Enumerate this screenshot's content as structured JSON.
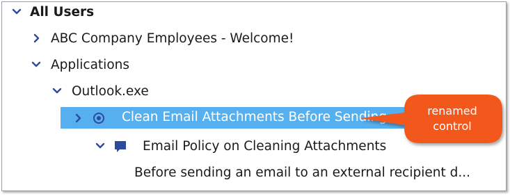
{
  "tree": {
    "root": {
      "label": "All Users"
    },
    "items": [
      {
        "label": "ABC Company Employees - Welcome!"
      },
      {
        "label": "Applications"
      },
      {
        "label": "Outlook.exe"
      },
      {
        "label": "Clean Email Attachments Before Sending"
      },
      {
        "label": "Email Policy on Cleaning Attachments"
      },
      {
        "label": "Before sending an email to an external recipient d..."
      }
    ]
  },
  "callout": {
    "line1": "renamed",
    "line2": "control"
  },
  "colors": {
    "selection": "#56b0ef",
    "chevron": "#2e4a9a",
    "callout": "#f2581e"
  },
  "icons": {
    "expand": "chevron-right-icon",
    "collapse": "chevron-down-icon",
    "control": "radio-target-icon",
    "message": "speech-bubble-icon"
  }
}
